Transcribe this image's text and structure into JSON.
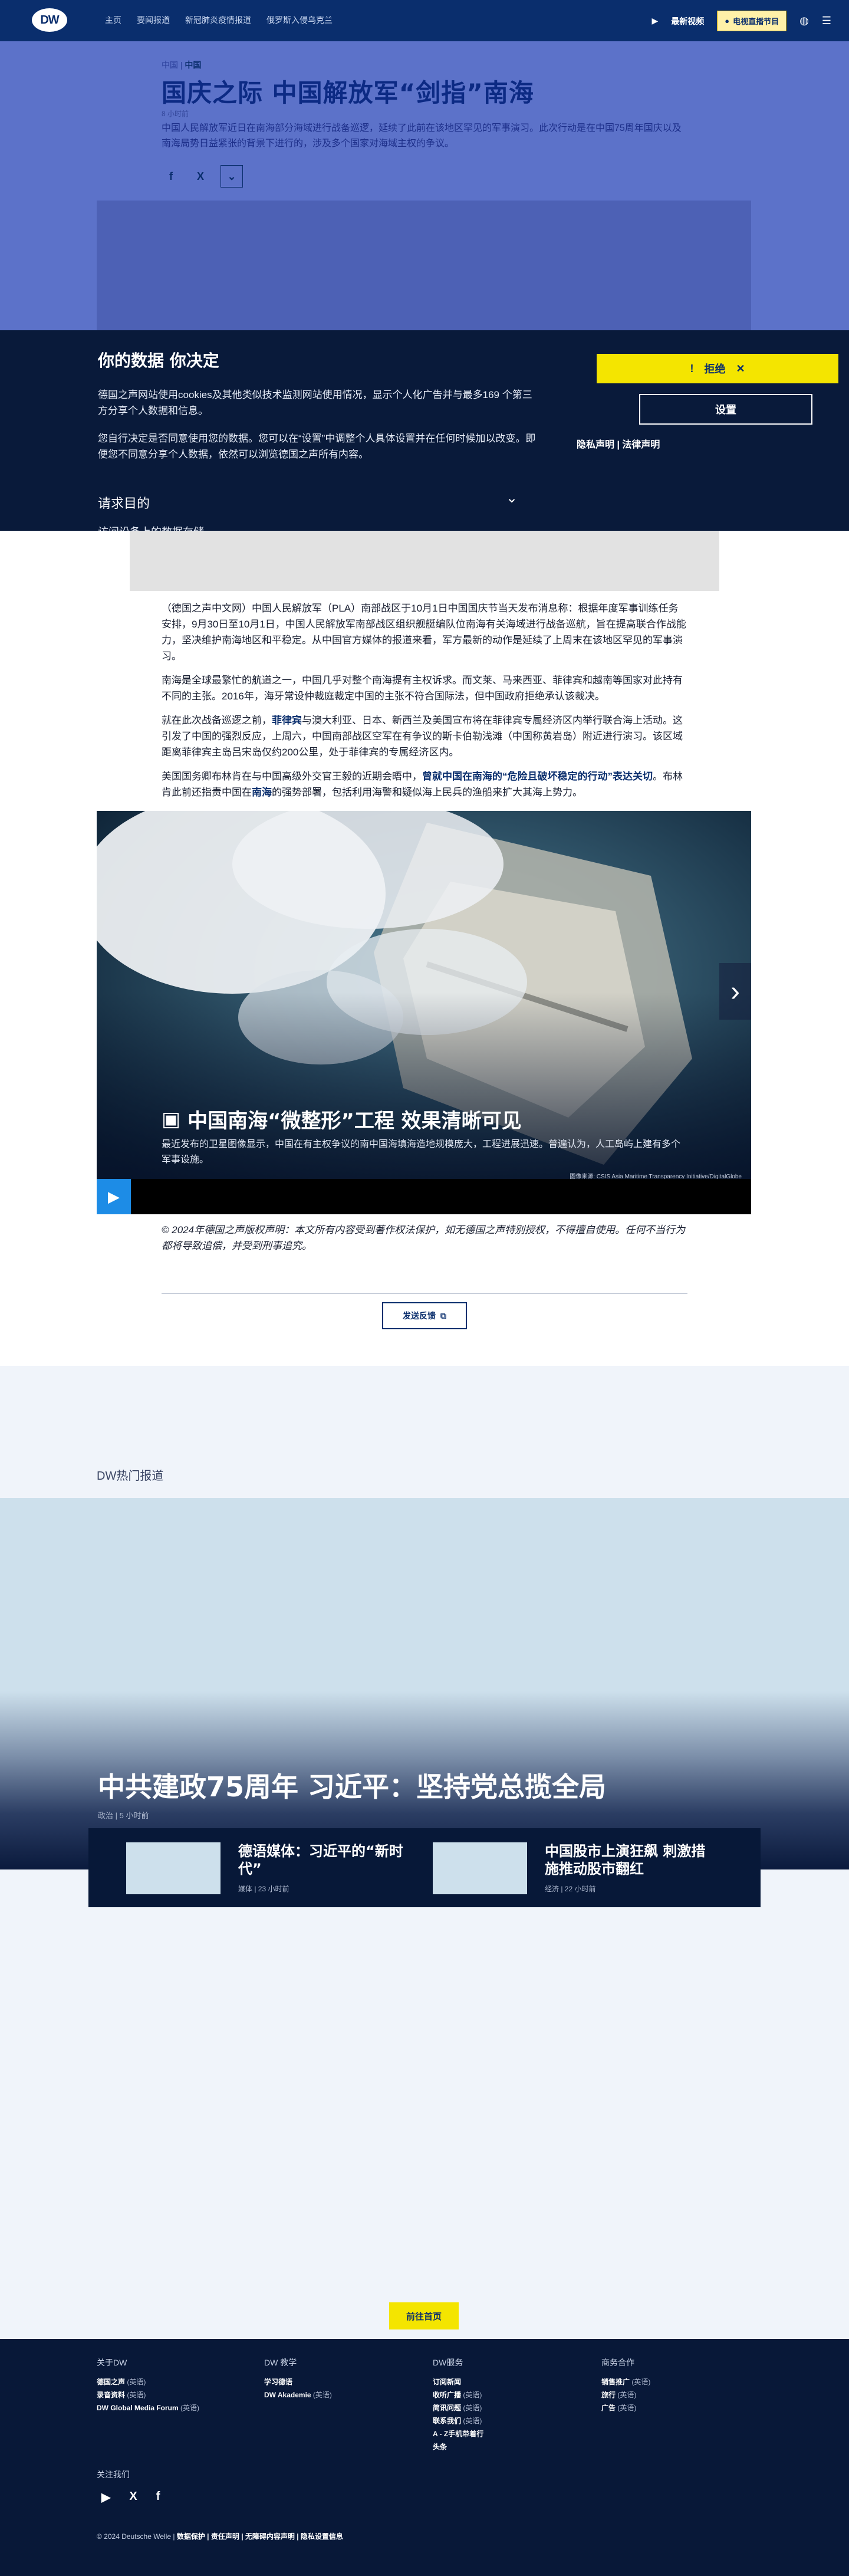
{
  "nav": {
    "logo": "DW",
    "links": [
      "主页",
      "要闻报道",
      "新冠肺炎疫情报道",
      "俄罗斯入侵乌克兰"
    ],
    "live_label": "最新视频",
    "tv_label": "电视直播节目"
  },
  "article": {
    "breadcrumb_prefix": "中国",
    "breadcrumb": "中国",
    "title": "国庆之际 中国解放军“剑指”南海",
    "time": "8 小时前",
    "lead": "中国人民解放军近日在南海部分海域进行战备巡逻，延续了此前在该地区罕见的军事演习。此次行动是在中国75周年国庆以及南海局势日益紧张的背景下进行的，涉及多个国家对海域主权的争议。",
    "paragraphs": [
      "（德国之声中文网）中国人民解放军（PLA）南部战区于10月1日中国国庆节当天发布消息称：根据年度军事训练任务安排，9月30日至10月1日，中国人民解放军南部战区组织舰艇编队位南海有关海域进行战备巡航，旨在提高联合作战能力，坚决维护南海地区和平稳定。从中国官方媒体的报道来看，军方最新的动作是延续了上周末在该地区罕见的军事演习。",
      "南海是全球最繁忙的航道之一，中国几乎对整个南海提有主权诉求。而文莱、马来西亚、菲律宾和越南等国家对此持有不同的主张。2016年，海牙常设仲裁庭裁定中国的主张不符合国际法，但中国政府拒绝承认该裁决。",
      "就在此次战备巡逻之前，菲律宾与澳大利亚、日本、新西兰及美国宣布将在菲律宾专属经济区内举行联合海上活动。这引发了中国的强烈反应，上周六，中国南部战区空军在有争议的斯卡伯勒浅滩（中国称黄岩岛）附近进行演习。该区域距离菲律宾主岛吕宋岛仅约200公里，处于菲律宾的专属经济区内。",
      "美国国务卿布林肯在与中国高级外交官王毅的近期会晤中，曾就中国在南海的“危险且破坏稳定的行动”表达关切。布林肯此前还指责中国在南海的强势部署，包括利用海警和疑似海上民兵的渔船来扩大其海上势力。"
    ],
    "p3_prefix": "就在此次战备巡逻之前，",
    "p3_link": "菲律宾",
    "p3_rest": "与澳大利亚、日本、新西兰及美国宣布将在菲律宾专属经济区内举行联合海上活动。这引发了中国的强烈反应，上周六，中国南部战区空军在有争议的斯卡伯勒浅滩（中国称黄岩岛）附近进行演习。该区域距离菲律宾主岛吕宋岛仅约200公里，处于菲律宾的专属经济区内。",
    "p4_prefix": "美国国务卿布林肯在与中国高级外交官王毅的近期会晤中，",
    "p4_link": "曾就中国在南海的“危险且破坏稳定的行动”表达关切",
    "p4_mid": "。布林肯此前还指责中国在",
    "p4_link2": "南海",
    "p4_rest": "的强势部署，包括利用海警和疑似海上民兵的渔船来扩大其海上势力。",
    "copyright": "© 2024年德国之声版权声明：本文所有内容受到著作权法保护，如无德国之声特别授权，不得擅自使用。任何不当行为都将导致追偿，并受到刑事追究。",
    "feedback": "发送反馈"
  },
  "gallery": {
    "title": "中国南海“微整形”工程 效果清晰可见",
    "desc": "最近发布的卫星图像显示，中国在有主权争议的南中国海填海造地规模庞大，工程进展迅速。普遍认为，人工岛屿上建有多个军事设施。",
    "credit": "图像来源: CSIS Asia Maritime Transparency Initiative/DigitalGlobe"
  },
  "cookie": {
    "title": "你的数据 你决定",
    "p1": "德国之声网站使用cookies及其他类似技术监测网站使用情况，显示个人化广告并与最多169 个第三方分享个人数据和信息。",
    "p2": "您自行决定是否同意使用您的数据。您可以在“设置”中调整个人具体设置并在任何时候加以改变。即便您不同意分享个人数据，依然可以浏览德国之声所有内容。",
    "purpose": "请求目的",
    "reject": "拒绝",
    "settings": "设置",
    "links": "隐私声明 | 法律声明",
    "cut": "访问设备上的数据存储"
  },
  "hot": {
    "label": "DW热门报道",
    "feature_title": "中共建政75周年 习近平：坚持党总揽全局",
    "feature_meta": "政治 | 5 小时前",
    "cards": [
      {
        "title": "德语媒体：习近平的“新时代”",
        "meta": "媒体 | 23 小时前"
      },
      {
        "title": "中国股市上演狂飙 刺激措施推动股市翻红",
        "meta": "经济 | 22 小时前"
      }
    ]
  },
  "home_button": "前往首页",
  "footer": {
    "cols": [
      {
        "title": "关于DW",
        "items": [
          [
            "德国之声",
            "(英语)"
          ],
          [
            "录音资料",
            "(英语)"
          ],
          [
            "DW Global Media Forum",
            "(英语)"
          ]
        ]
      },
      {
        "title": "DW 教学",
        "items": [
          [
            "学习德语",
            ""
          ],
          [
            "DW Akademie",
            "(英语)"
          ]
        ]
      },
      {
        "title": "DW服务",
        "items": [
          [
            "订阅新闻",
            ""
          ],
          [
            "收听广播",
            "(英语)"
          ],
          [
            "简讯问题",
            "(英语)"
          ],
          [
            "联系我们",
            "(英语)"
          ],
          [
            "A - Z手机带着行",
            ""
          ],
          [
            "头条",
            ""
          ]
        ]
      },
      {
        "title": "商务合作",
        "items": [
          [
            "销售推广",
            "(英语)"
          ],
          [
            "旅行",
            "(英语)"
          ],
          [
            "广告",
            "(英语)"
          ]
        ]
      }
    ],
    "follow": "关注我们",
    "legal_prefix": "© 2024 Deutsche Welle |",
    "legal_links": "数据保护 | 责任声明 | 无障碍内容声明 | 隐私设置信息"
  }
}
